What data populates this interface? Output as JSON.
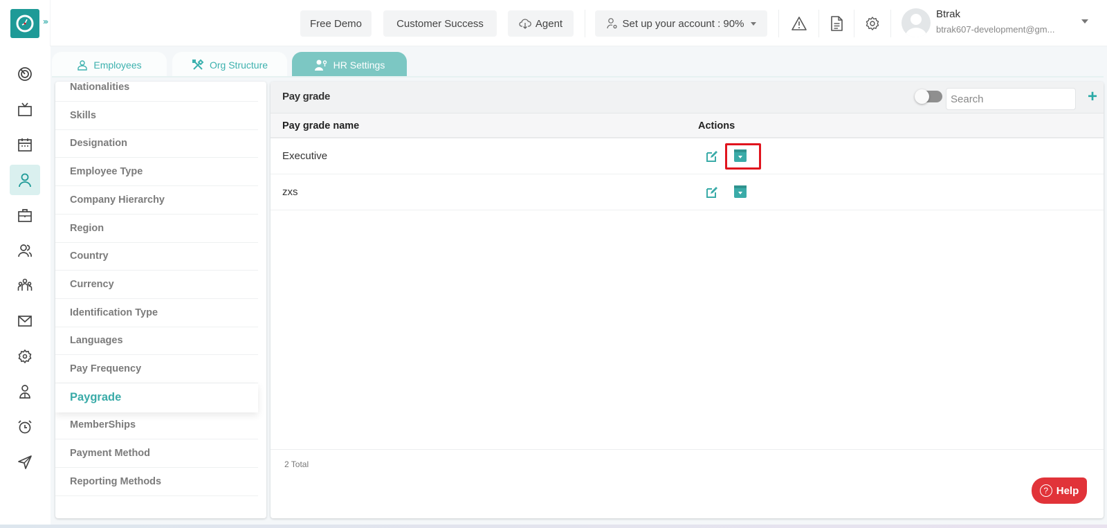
{
  "header": {
    "expand_glyph": "›››",
    "buttons": {
      "free_demo": "Free Demo",
      "customer_success": "Customer Success",
      "agent": "Agent",
      "setup": "Set up your account : 90%"
    },
    "setup_progress_percent": 90,
    "user": {
      "name": "Btrak",
      "email": "btrak607-development@gm..."
    }
  },
  "tabs": [
    {
      "label": "Employees",
      "icon": "user-icon",
      "active": false
    },
    {
      "label": "Org Structure",
      "icon": "tools-icon",
      "active": false
    },
    {
      "label": "HR Settings",
      "icon": "user-settings-icon",
      "active": true
    }
  ],
  "leftnav": [
    {
      "icon": "dashboard-icon",
      "active": false
    },
    {
      "icon": "tv-icon",
      "active": false
    },
    {
      "icon": "calendar-icon",
      "active": false
    },
    {
      "icon": "user-icon",
      "active": true
    },
    {
      "icon": "briefcase-icon",
      "active": false
    },
    {
      "icon": "users-icon",
      "active": false
    },
    {
      "icon": "team-icon",
      "active": false
    },
    {
      "icon": "mail-icon",
      "active": false
    },
    {
      "icon": "settings-icon",
      "active": false
    },
    {
      "icon": "profile-icon",
      "active": false
    },
    {
      "icon": "alarm-icon",
      "active": false
    },
    {
      "icon": "send-icon",
      "active": false
    }
  ],
  "settings_menu": [
    "Nationalities",
    "Skills",
    "Designation",
    "Employee Type",
    "Company Hierarchy",
    "Region",
    "Country",
    "Currency",
    "Identification Type",
    "Languages",
    "Pay Frequency",
    "Paygrade",
    "MemberShips",
    "Payment Method",
    "Reporting Methods"
  ],
  "settings_active": "Paygrade",
  "panel": {
    "title": "Pay grade",
    "search_placeholder": "Search",
    "add_label": "+",
    "columns": {
      "name": "Pay grade name",
      "actions": "Actions"
    },
    "rows": [
      {
        "name": "Executive"
      },
      {
        "name": "zxs"
      }
    ],
    "total": "2 Total"
  },
  "help": {
    "label": "Help",
    "glyph": "?"
  },
  "colors": {
    "brand": "#1e9a97",
    "accent": "#3aaba8",
    "tab_active": "#7cc7c3",
    "help": "#e13339",
    "highlight": "#e0141e"
  }
}
